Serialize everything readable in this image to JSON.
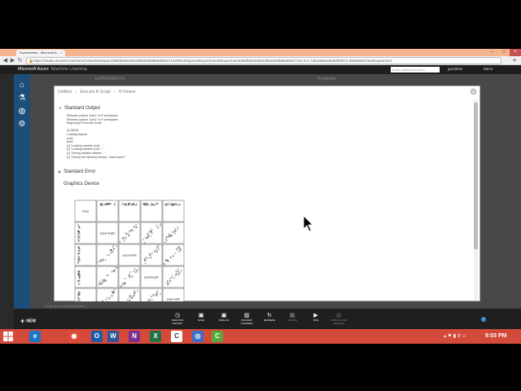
{
  "browser": {
    "tab_title": "Experiments - Microsoft A...",
    "tab_close": "×",
    "url": "https://studio.azureml.net/Home/ViewWorkspace/365fe9281b842bba52598566f5927124#Workspaces/Experiments/Experiment/365fe9281b842bba525985665927124 6-0 7d&4a66a49a40f48074 5fe8eb62/ViewExperiment",
    "window_controls": [
      "–",
      "□",
      "×"
    ],
    "back_glyph": "◀",
    "forward_glyph": "▶",
    "reload_glyph": "↻",
    "lock_glyph": "🔒",
    "menu_glyph": "≡"
  },
  "app": {
    "brand": "Microsoft Azure",
    "product": "Machine Learning",
    "search_placeholder": "Enter Intellisense term",
    "user": "gornitism",
    "menu_label": "Menu",
    "bg_label_left": "EXPERIMENTS",
    "bg_label_right": "Properties",
    "bg_checkbox": "Show Terms Summarization"
  },
  "nav": [
    {
      "name": "home-icon",
      "glyph": "⌂"
    },
    {
      "name": "flask-icon",
      "glyph": "⚗"
    },
    {
      "name": "globe-icon",
      "glyph": "◍"
    },
    {
      "name": "gear-icon",
      "glyph": "⚙"
    }
  ],
  "modal": {
    "breadcrumb": [
      "Untitled",
      "›",
      "Execute R Script",
      "›",
      "R Device"
    ],
    "close_glyph": "✕",
    "standard_output_title": "Standard Output",
    "output_lines": [
      "RWorker pushed \"port1\" to R workspace.",
      "RWorker pushed \"port1\" to R workspace.",
      "Beginning R Execute Script",
      "",
      "[1] 56000",
      "Loading objects:",
      "  port1",
      "  port1",
      "[1] \"Loading variable port1...\"",
      "[1] \"Loading variable port1...\"",
      "[1] \"Saving variable  dataset  ...\"",
      "[1] \"Saving the following item(s):  .maml.oport1\""
    ],
    "standard_error_title": "Standard Error",
    "graphics_title": "Graphics Device",
    "pairs_labels": [
      "Class",
      "sepal-length",
      "sepal-width",
      "petal-length",
      "petal-width"
    ]
  },
  "bottom": {
    "new_label": "NEW",
    "new_glyph": "+",
    "commands": [
      {
        "name": "run-history-button",
        "label": "VIEW RUN HISTORY",
        "glyph": "◷",
        "enabled": true
      },
      {
        "name": "save-button",
        "label": "SAVE",
        "glyph": "▣",
        "enabled": true
      },
      {
        "name": "save-as-button",
        "label": "SAVE AS",
        "glyph": "▣",
        "enabled": true
      },
      {
        "name": "discard-changes-button",
        "label": "DISCARD CHANGES",
        "glyph": "▥",
        "enabled": true
      },
      {
        "name": "refresh-button",
        "label": "REFRESH",
        "glyph": "↻",
        "enabled": true
      },
      {
        "name": "create-button",
        "label": "CREATE",
        "glyph": "▦",
        "enabled": false
      },
      {
        "name": "run-button",
        "label": "RUN",
        "glyph": "▶",
        "enabled": true
      },
      {
        "name": "publish-button",
        "label": "PUBLISH WEB SERVICE",
        "glyph": "◎",
        "enabled": false
      }
    ]
  },
  "taskbar": {
    "apps": [
      {
        "name": "ie-icon",
        "glyph": "e",
        "color": "#1e74c8"
      },
      {
        "name": "chrome-icon",
        "glyph": "◉",
        "color": "#e04b3a"
      },
      {
        "name": "outlook-icon",
        "glyph": "O",
        "color": "#1f5ca8"
      },
      {
        "name": "word-icon",
        "glyph": "W",
        "color": "#2b579a"
      },
      {
        "name": "onenote-icon",
        "glyph": "N",
        "color": "#7b2f8f"
      },
      {
        "name": "excel-icon",
        "glyph": "X",
        "color": "#217346"
      },
      {
        "name": "camtasia-icon",
        "glyph": "C",
        "color": "#ffffff"
      },
      {
        "name": "browser-blue-icon",
        "glyph": "◎",
        "color": "#3a6fc4"
      },
      {
        "name": "camtasia-green-icon",
        "glyph": "C",
        "color": "#5aa63a"
      }
    ],
    "tray": "▴ ⚑ ▮ ⚲ ♫",
    "time": "9:03 PM"
  },
  "colors": {
    "accent": "#1c4e7a",
    "taskbar": "#d44a3a",
    "tabstrip": "#f6b48e"
  }
}
